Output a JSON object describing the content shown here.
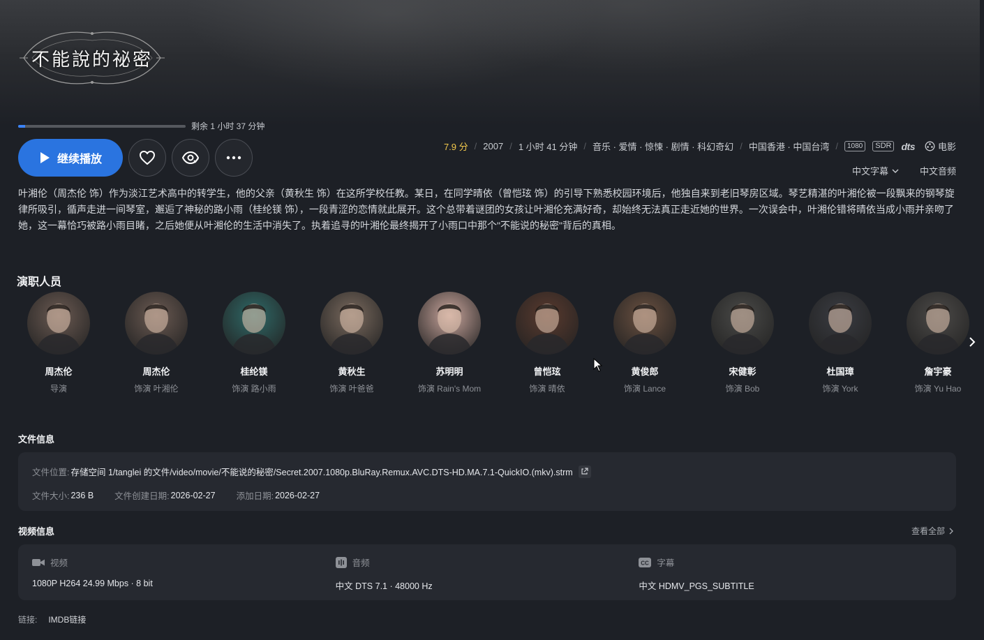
{
  "hero": {
    "logo_text": "不能說的祕密"
  },
  "progress": {
    "fraction": 0.04,
    "remaining_text": "剩余 1 小时 37 分钟"
  },
  "actions": {
    "play_label": "继续播放",
    "favorite_icon": "heart-icon",
    "watched_icon": "eye-icon",
    "more_icon": "more-icon"
  },
  "meta": {
    "rating": "7.9 分",
    "year": "2007",
    "duration": "1 小时 41 分钟",
    "genres": "音乐 · 爱情 · 惊悚 · 剧情 · 科幻奇幻",
    "regions": "中国香港 · 中国台湾",
    "badge_resolution": "1080",
    "badge_range": "SDR",
    "badge_audio": "dts",
    "type": "电影"
  },
  "language": {
    "subtitle": "中文字幕",
    "audio": "中文音频"
  },
  "overview": "叶湘伦（周杰伦 饰）作为淡江艺术高中的转学生，他的父亲（黄秋生 饰）在这所学校任教。某日，在同学晴依（曾恺玹 饰）的引导下熟悉校园环境后，他独自来到老旧琴房区域。琴艺精湛的叶湘伦被一段飘来的钢琴旋律所吸引，循声走进一间琴室，邂逅了神秘的路小雨（桂纶镁 饰），一段青涩的恋情就此展开。这个总带着谜团的女孩让叶湘伦充满好奇，却始终无法真正走近她的世界。一次误会中，叶湘伦错将晴依当成小雨并亲吻了她，这一幕恰巧被路小雨目睹，之后她便从叶湘伦的生活中消失了。执着追寻的叶湘伦最终揭开了小雨口中那个\"不能说的秘密\"背后的真相。",
  "cast": {
    "title": "演职人员",
    "items": [
      {
        "name": "周杰伦",
        "role": "导演",
        "color": "#6b5a52"
      },
      {
        "name": "周杰伦",
        "role": "饰演 叶湘伦",
        "color": "#6b5a52"
      },
      {
        "name": "桂纶镁",
        "role": "饰演 路小雨",
        "color": "#2f6a68"
      },
      {
        "name": "黄秋生",
        "role": "饰演 叶爸爸",
        "color": "#7a6a5e"
      },
      {
        "name": "苏明明",
        "role": "饰演 Rain's Mom",
        "color": "#c9a59c"
      },
      {
        "name": "曾恺玹",
        "role": "饰演 晴依",
        "color": "#5a3a2e"
      },
      {
        "name": "黄俊郎",
        "role": "饰演 Lance",
        "color": "#6a5040"
      },
      {
        "name": "宋健彰",
        "role": "饰演 Bob",
        "color": "#4a4a48"
      },
      {
        "name": "杜国璋",
        "role": "饰演 York",
        "color": "#3a3c42"
      },
      {
        "name": "詹宇豪",
        "role": "饰演 Yu Hao",
        "color": "#4c4a48"
      }
    ]
  },
  "file_info": {
    "title": "文件信息",
    "location_label": "文件位置:",
    "location_value": "存储空间 1/tanglei 的文件/video/movie/不能说的秘密/Secret.2007.1080p.BluRay.Remux.AVC.DTS-HD.MA.7.1-QuickIO.(mkv).strm",
    "size_label": "文件大小:",
    "size_value": "236 B",
    "created_label": "文件创建日期:",
    "created_value": "2026-02-27",
    "added_label": "添加日期:",
    "added_value": "2026-02-27"
  },
  "video_info": {
    "title": "视频信息",
    "view_all": "查看全部",
    "video_label": "视频",
    "video_value": "1080P H264 24.99 Mbps · 8 bit",
    "audio_label": "音频",
    "audio_value": "中文 DTS 7.1 · 48000 Hz",
    "subtitle_label": "字幕",
    "subtitle_value": "中文 HDMV_PGS_SUBTITLE"
  },
  "links": {
    "label": "链接:",
    "imdb": "IMDB链接"
  }
}
